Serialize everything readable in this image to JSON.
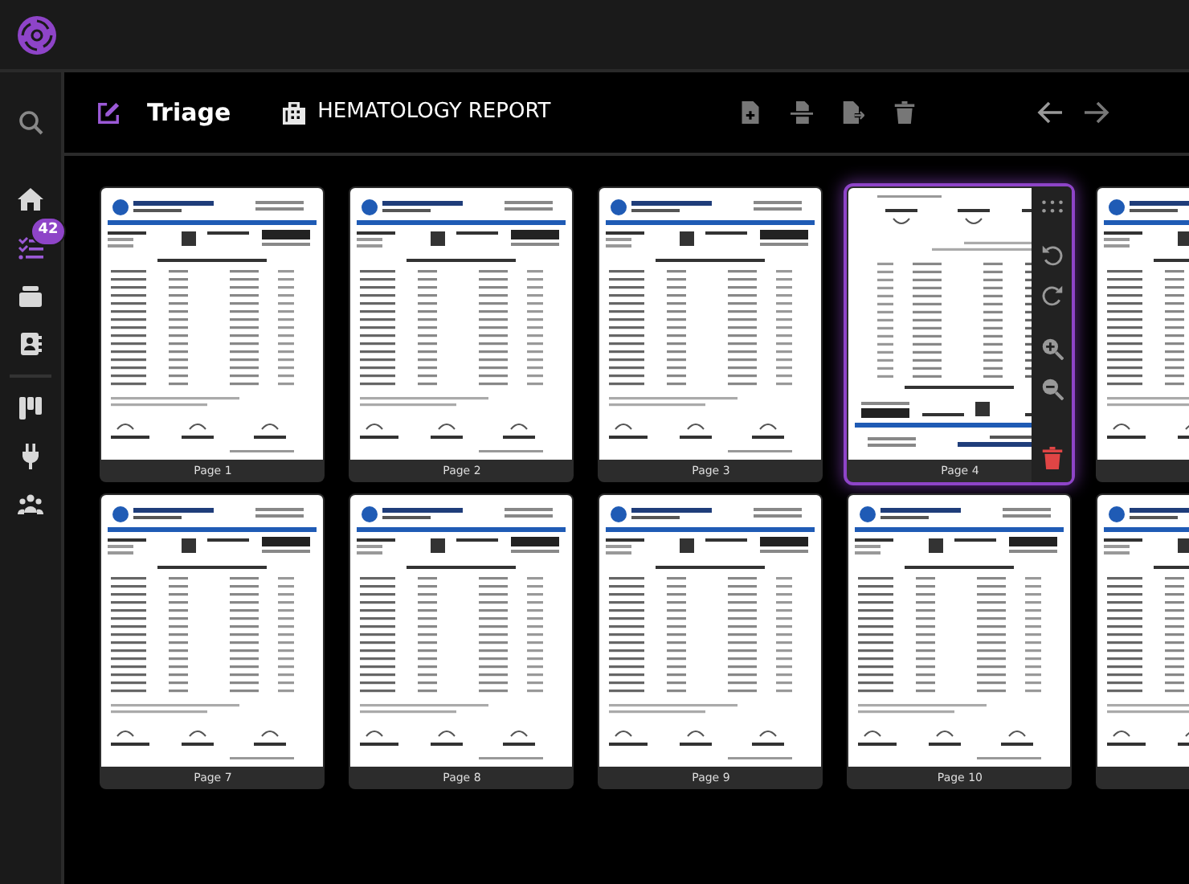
{
  "sidebar": {
    "items": [
      {
        "kind": "search",
        "selected": false
      },
      {
        "kind": "home",
        "selected": false
      },
      {
        "kind": "tasks",
        "selected": true,
        "badge": "42"
      },
      {
        "kind": "drawer",
        "selected": false
      },
      {
        "kind": "contacts",
        "selected": false
      },
      {
        "kind": "divider"
      },
      {
        "kind": "board",
        "selected": false
      },
      {
        "kind": "plug",
        "selected": false
      },
      {
        "kind": "people",
        "selected": false
      }
    ]
  },
  "header": {
    "mode": "Triage",
    "document": "HEMATOLOGY REPORT"
  },
  "pages": [
    {
      "label": "Page 1",
      "selected": false,
      "upside_down": false
    },
    {
      "label": "Page 2",
      "selected": false,
      "upside_down": false
    },
    {
      "label": "Page 3",
      "selected": false,
      "upside_down": false
    },
    {
      "label": "Page 4",
      "selected": true,
      "upside_down": true
    },
    {
      "selected": false,
      "upside_down": false
    },
    {
      "label": "Page 7",
      "selected": false,
      "upside_down": false
    },
    {
      "label": "Page 8",
      "selected": false,
      "upside_down": false
    },
    {
      "label": "Page 9",
      "selected": false,
      "upside_down": false
    },
    {
      "label": "Page 10",
      "selected": false,
      "upside_down": false
    },
    {
      "selected": false,
      "upside_down": false
    }
  ]
}
